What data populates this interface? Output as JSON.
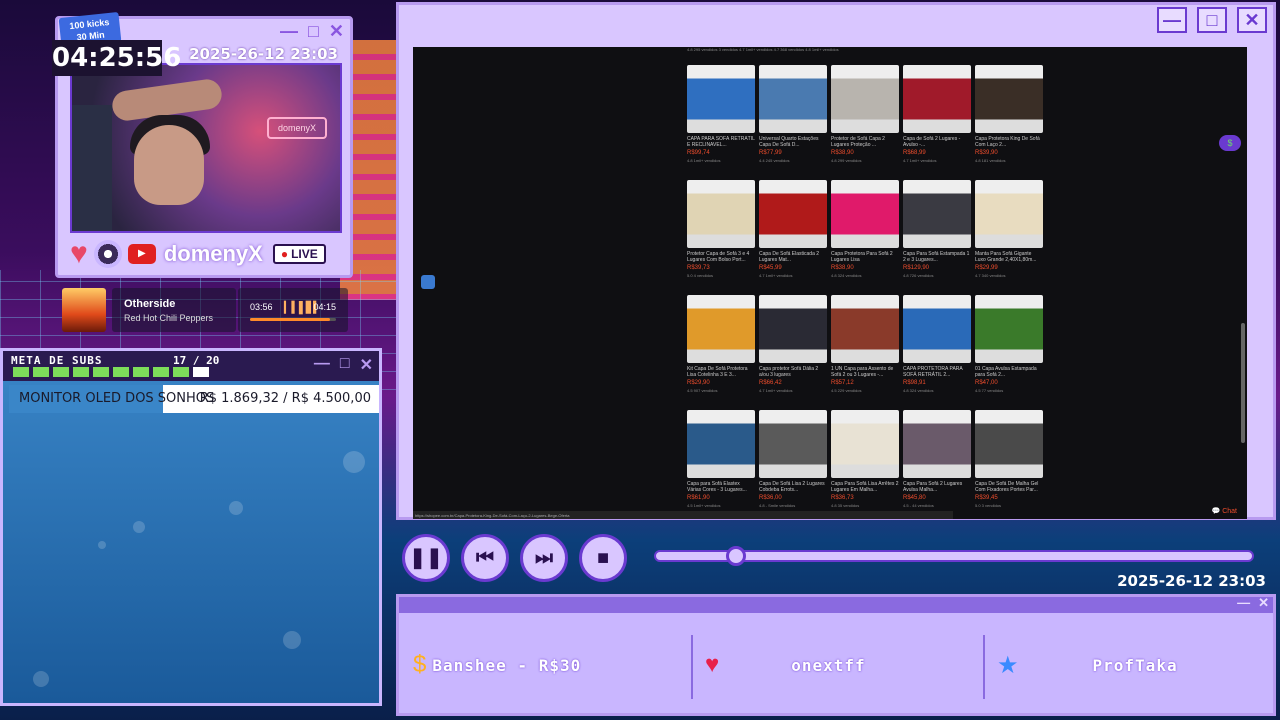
{
  "webcam": {
    "kicks_line1": "100 kicks",
    "kicks_line2": "30 Min",
    "timer": "04:25:56",
    "date": "2025-26-12 23:03",
    "neon_sign": "domenyX",
    "channel_name": "domenyX",
    "live_label": "LIVE",
    "window_buttons": [
      "—",
      "□",
      "✕"
    ]
  },
  "music": {
    "title": "Otherside",
    "artist": "Red Hot Chili Peppers",
    "current_time": "03:56",
    "total_time": "04:15",
    "progress": 0.93
  },
  "subs_goal": {
    "title": "META DE SUBS",
    "count": "17 / 20",
    "current": 17,
    "target": 20,
    "goal_label": "MONITOR OLED DOS SONHOS",
    "goal_value": "R$ 1.869,32 / R$ 4.500,00",
    "goal_progress": 0.415,
    "colors": {
      "filled": "#7ddc5a",
      "empty": "#ffffff"
    }
  },
  "browser": {
    "window_buttons": [
      "—",
      "□",
      "✕"
    ],
    "top_strip": "4.8 295 vendidos     3 vendidos     4.7 1mil+ vendidos     4.7 368 vendidos     4.8 1mil+ vendidos",
    "products": [
      {
        "title": "CAPA PARA SOFÁ RETRÁTIL E RECLINAVEL...",
        "price": "R$99,74",
        "meta": "4.8 1mil+ vendidos",
        "color": "#2f6fc0"
      },
      {
        "title": "Universal Quarto Estações Capa De Sofá D...",
        "price": "R$77,99",
        "meta": "4.4 245 vendidos",
        "color": "#4a7ab0"
      },
      {
        "title": "Protetor de Sofá Capa 2 Lugares Proteção ...",
        "price": "R$38,90",
        "meta": "4.8 299 vendidos",
        "color": "#b8b4ae"
      },
      {
        "title": "Capa de Sofá 2 Lugares - Avulso -...",
        "price": "R$68,99",
        "meta": "4.7 1mil+ vendidos",
        "color": "#a01a2a"
      },
      {
        "title": "Capa Protetora King De Sofá Com Laço 2...",
        "price": "R$39,90",
        "meta": "4.8 181 vendidos",
        "color": "#3a2e26"
      },
      {
        "title": "Protetor Capa de Sofá 3 e 4 Lugares Com Bolso Port...",
        "price": "R$39,73",
        "meta": "5.0 4 vendidos",
        "color": "#e0d4b4"
      },
      {
        "title": "Capa De Sofá Elasticada 2 Lugares Mat...",
        "price": "R$45,99",
        "meta": "4.7 1mil+ vendidos",
        "color": "#b01a1a"
      },
      {
        "title": "Capa Protetora Para Sofá 2 Lugares Lisa",
        "price": "R$38,90",
        "meta": "4.8 324 vendidos",
        "color": "#e01a6a"
      },
      {
        "title": "Capa Para Sofá Estampada 1 2 e 3 Lugares...",
        "price": "R$129,90",
        "meta": "4.8 726 vendidos",
        "color": "#3a3a42"
      },
      {
        "title": "Manta Para Sofá Gigante Luxo Grande 2,40X1,80m...",
        "price": "R$29,99",
        "meta": "4.7 340 vendidos",
        "color": "#e8dcc0"
      },
      {
        "title": "Kit Capa De Sofá Protetora Lisa Cotelinha 3 E 3...",
        "price": "R$29,90",
        "meta": "4.5 907 vendidos",
        "color": "#e09a2a"
      },
      {
        "title": "Capa protetor Sofá Dália 2 a/ou 3 lugares",
        "price": "R$66,42",
        "meta": "4.7 1mil+ vendidos",
        "color": "#2a2a34"
      },
      {
        "title": "1 UN Capa para Assento de Sofá 2 ou 3 Lugares -...",
        "price": "R$57,12",
        "meta": "4.5 229 vendidos",
        "color": "#8a3a2a"
      },
      {
        "title": "CAPA PROTETORA PARA SOFÁ RETRÁTIL 2...",
        "price": "R$98,91",
        "meta": "4.8 324 vendidos",
        "color": "#2a6ab8"
      },
      {
        "title": "01 Capa Avulsa Estampada para Sofá 2...",
        "price": "R$47,00",
        "meta": "4.5 77 vendidos",
        "color": "#3a7a2a"
      },
      {
        "title": "Capa para Sofá Elastex Várias Cores - 3 Lugares...",
        "price": "R$61,90",
        "meta": "4.5 1mil+ vendidos",
        "color": "#2a5a8a"
      },
      {
        "title": "Capa De Sofá Lisa 2 Lugares Cobdeba Errots...",
        "price": "R$36,00",
        "meta": "4.8 - Smile vendidos",
        "color": "#5a5a5a"
      },
      {
        "title": "Capa Para Sofá Lisa Arrêtes 2 Lugares Em Malha...",
        "price": "R$36,73",
        "meta": "4.8 35 vendidos",
        "color": "#e8e2d4"
      },
      {
        "title": "Capa Para Sofá 2 Lugares Avulsa Malha...",
        "price": "R$45,80",
        "meta": "4.5 - 44 vendidos",
        "color": "#6a5a6a"
      },
      {
        "title": "Capa De Sofá De Malha Gel Com Fixadores Portes Par...",
        "price": "R$39,45",
        "meta": "5.0 3 vendidos",
        "color": "#4a4a4a"
      }
    ],
    "status_url": "https://shopee.com.br/Capa-Protetora-King-De-Sofá-Com-Laço-2-Lugares-Bege-Oferta",
    "chat_label": "Chat"
  },
  "controls": {
    "buttons": [
      "❚❚",
      "⏮",
      "⏭",
      "■"
    ],
    "seek_progress": 0.12,
    "date": "2025-26-12 23:03"
  },
  "alerts": {
    "sub_alert": "Banshee - R$30",
    "follower": "onextff",
    "star_user": "ProfTaka",
    "window_buttons": [
      "—",
      "✕"
    ]
  }
}
